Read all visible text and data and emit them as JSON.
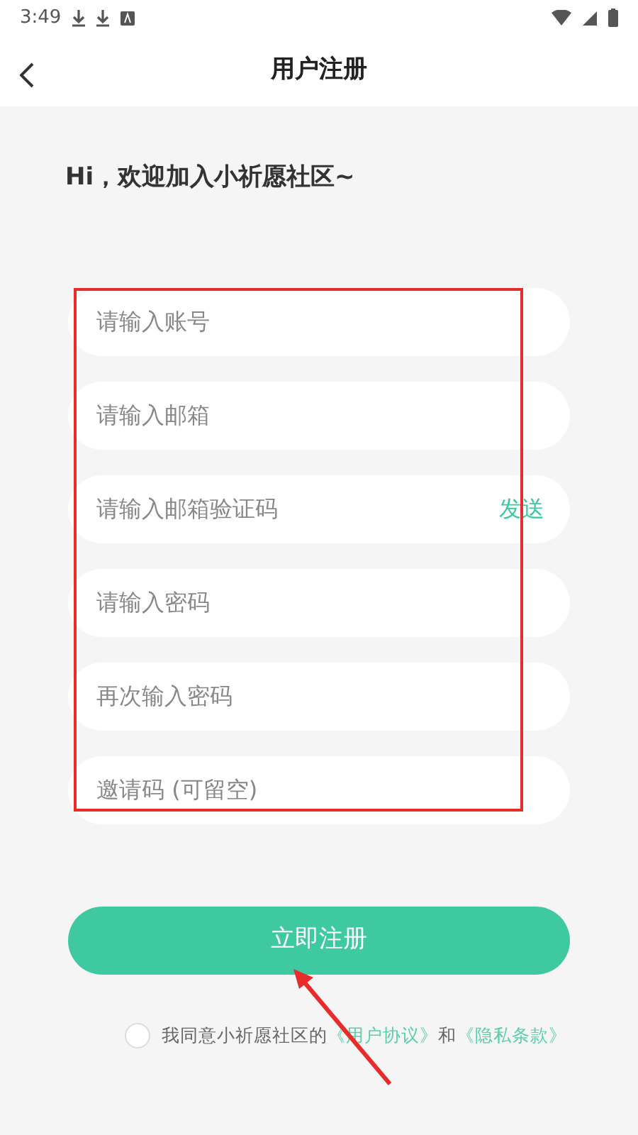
{
  "status_bar": {
    "time": "3:49"
  },
  "header": {
    "title": "用户注册"
  },
  "greeting": "Hi，欢迎加入小祈愿社区~",
  "fields": [
    {
      "placeholder": "请输入账号"
    },
    {
      "placeholder": "请输入邮箱"
    },
    {
      "placeholder": "请输入邮箱验证码",
      "action": "发送"
    },
    {
      "placeholder": "请输入密码"
    },
    {
      "placeholder": "再次输入密码"
    },
    {
      "placeholder": "邀请码 (可留空)"
    }
  ],
  "register_button": "立即注册",
  "agreement": {
    "checked": false,
    "text": "我同意小祈愿社区的",
    "links": [
      "《用户协议》",
      "《隐私条款》"
    ],
    "joiner": "和"
  }
}
